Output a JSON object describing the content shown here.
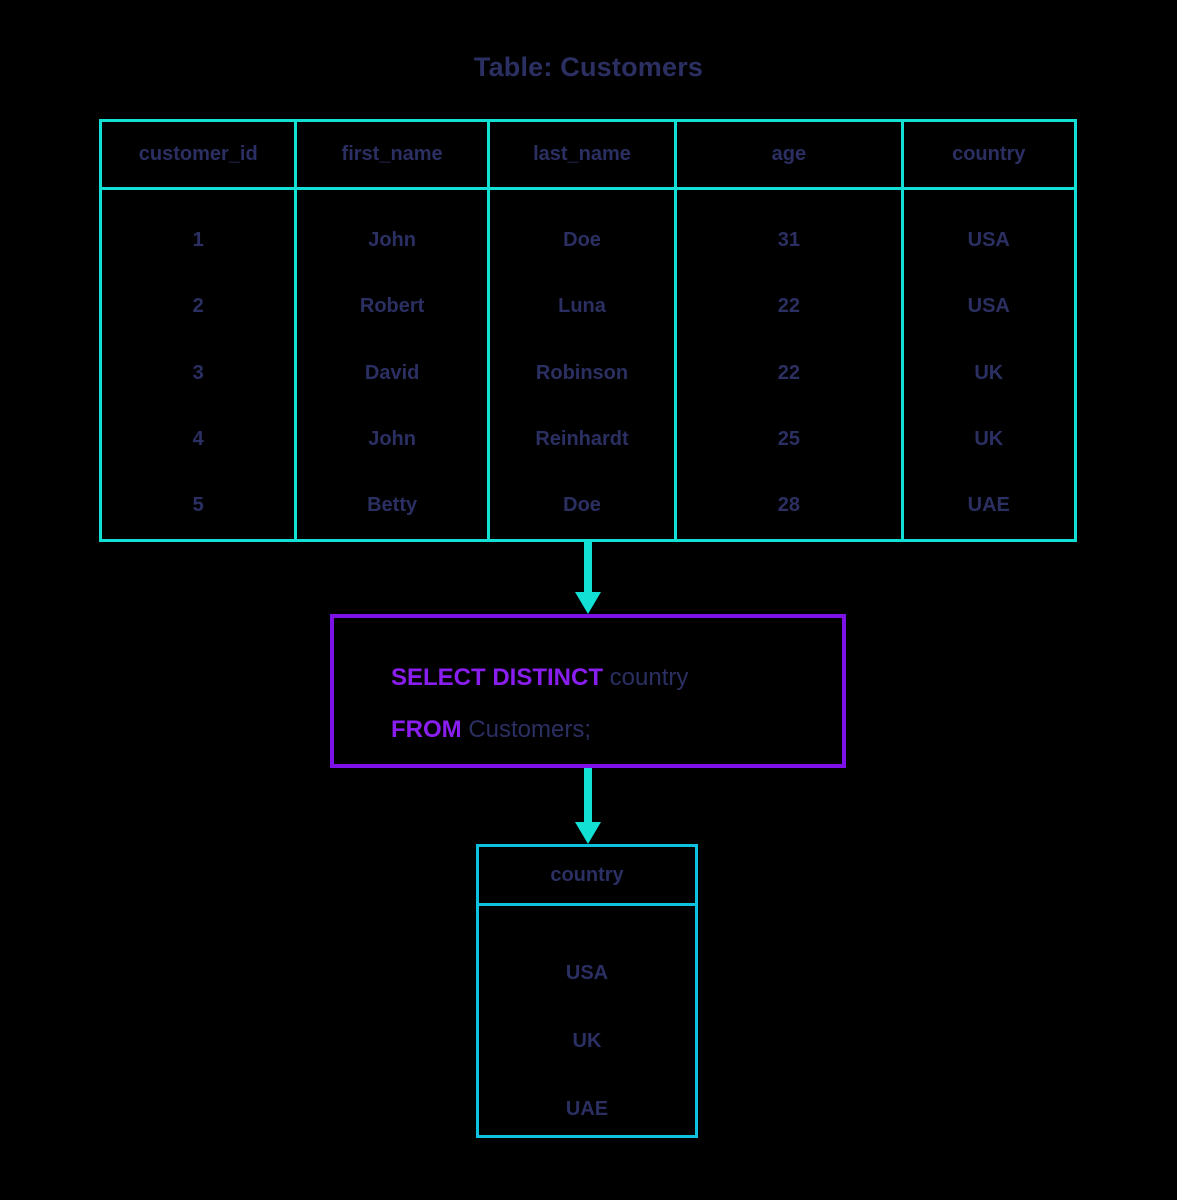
{
  "title": "Table: Customers",
  "colors": {
    "background": "#000000",
    "text_navy": "#2b2f62",
    "table_border_cyan": "#12e0d4",
    "result_border_cyan": "#0cc2e0",
    "query_border_purple": "#7d12e8",
    "keyword_purple": "#8a1ef0",
    "arrow_cyan": "#12e0d4"
  },
  "source_table": {
    "name": "Customers",
    "columns": [
      "customer_id",
      "first_name",
      "last_name",
      "age",
      "country"
    ],
    "rows": [
      [
        "1",
        "John",
        "Doe",
        "31",
        "USA"
      ],
      [
        "2",
        "Robert",
        "Luna",
        "22",
        "USA"
      ],
      [
        "3",
        "David",
        "Robinson",
        "22",
        "UK"
      ],
      [
        "4",
        "John",
        "Reinhardt",
        "25",
        "UK"
      ],
      [
        "5",
        "Betty",
        "Doe",
        "28",
        "UAE"
      ]
    ]
  },
  "query": {
    "line1": {
      "keyword": "SELECT DISTINCT",
      "rest": " country"
    },
    "line2": {
      "keyword": "FROM",
      "rest": " Customers;"
    },
    "full_text": "SELECT DISTINCT country FROM Customers;"
  },
  "result_table": {
    "columns": [
      "country"
    ],
    "rows": [
      [
        "USA"
      ],
      [
        "UK"
      ],
      [
        "UAE"
      ]
    ]
  },
  "arrows": [
    {
      "name": "arrow-table-to-query",
      "direction": "down"
    },
    {
      "name": "arrow-query-to-result",
      "direction": "down"
    }
  ]
}
